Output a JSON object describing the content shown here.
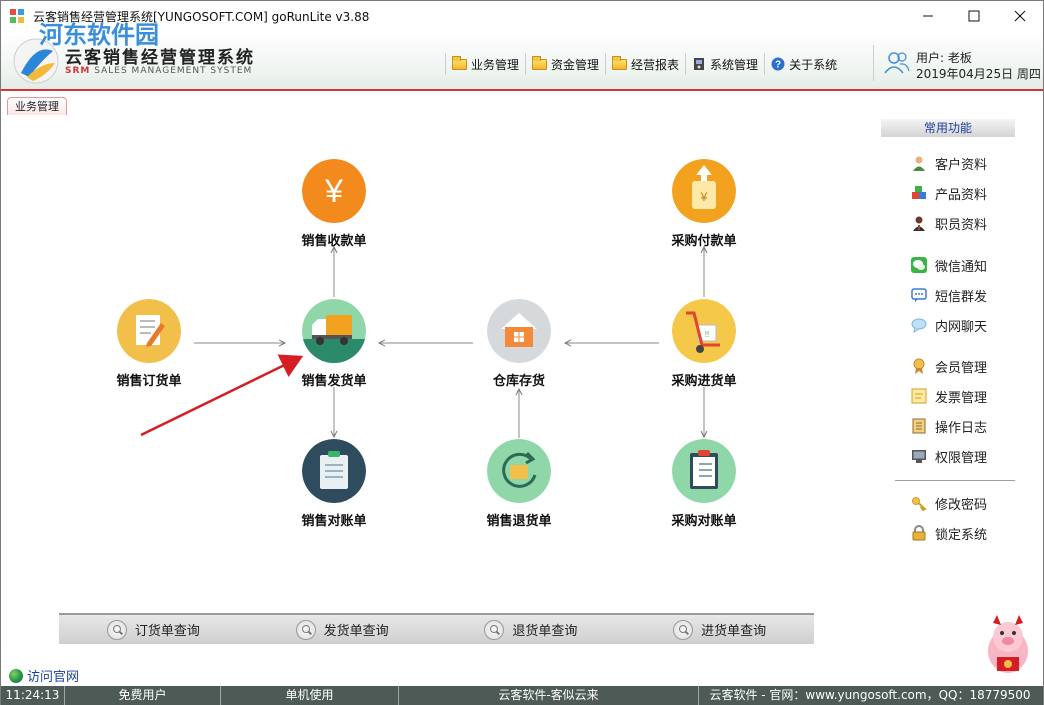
{
  "window": {
    "title": "云客销售经营管理系统[YUNGOSOFT.COM]  goRunLite v3.88",
    "controls": [
      "minimize",
      "maximize",
      "close"
    ]
  },
  "header": {
    "watermark": "河东软件园",
    "logo_title": "云客销售经营管理系统",
    "logo_sub_srm": "SRM",
    "logo_sub_rest": "SALES MANAGEMENT SYSTEM",
    "menu": [
      {
        "label": "业务管理",
        "icon": "folder-icon"
      },
      {
        "label": "资金管理",
        "icon": "folder-icon"
      },
      {
        "label": "经营报表",
        "icon": "folder-icon"
      },
      {
        "label": "系统管理",
        "icon": "settings-icon"
      },
      {
        "label": "关于系统",
        "icon": "help-icon"
      }
    ],
    "user_label": "用户: 老板",
    "date": "2019年04月25日 周四"
  },
  "tab": {
    "label": "业务管理"
  },
  "flow": {
    "nodes": {
      "sales_receipt": "销售收款单",
      "purchase_payment": "采购付款单",
      "sales_order": "销售订货单",
      "sales_delivery": "销售发货单",
      "warehouse_stock": "仓库存货",
      "purchase_receiving": "采购进货单",
      "sales_reconcile": "销售对账单",
      "sales_return": "销售退货单",
      "purchase_reconcile": "采购对账单"
    }
  },
  "sidebar": {
    "header": "常用功能",
    "items": [
      {
        "label": "客户资料",
        "icon": "customer-icon",
        "color": "#4a8c3a"
      },
      {
        "label": "产品资料",
        "icon": "product-icon",
        "color": "#3b7bd6"
      },
      {
        "label": "职员资料",
        "icon": "employee-icon",
        "color": "#b33a3a"
      },
      {
        "label": "微信通知",
        "icon": "wechat-icon",
        "color": "#3cb34a"
      },
      {
        "label": "短信群发",
        "icon": "sms-icon",
        "color": "#3b7bd6"
      },
      {
        "label": "内网聊天",
        "icon": "chat-icon",
        "color": "#7ab6e8"
      },
      {
        "label": "会员管理",
        "icon": "member-icon",
        "color": "#c98a2c"
      },
      {
        "label": "发票管理",
        "icon": "invoice-icon",
        "color": "#e8c54a"
      },
      {
        "label": "操作日志",
        "icon": "log-icon",
        "color": "#8a6a3a"
      },
      {
        "label": "权限管理",
        "icon": "permission-icon",
        "color": "#555555"
      },
      {
        "label": "修改密码",
        "icon": "key-icon",
        "color": "#c9a227"
      },
      {
        "label": "锁定系统",
        "icon": "lock-icon",
        "color": "#c9a227"
      }
    ]
  },
  "query_bar": [
    {
      "label": "订货单查询"
    },
    {
      "label": "发货单查询"
    },
    {
      "label": "退货单查询"
    },
    {
      "label": "进货单查询"
    }
  ],
  "visit_link": "访问官网",
  "status_bar": {
    "time": "11:24:13",
    "user_type": "免费用户",
    "mode": "单机使用",
    "slogan": "云客软件-客似云来",
    "website": "云客软件 - 官网：www.yungosoft.com，QQ：18779500"
  },
  "colors": {
    "accent_red": "#d4343b",
    "status_bar": "#4d5a55",
    "link_blue": "#1b3fa0"
  }
}
